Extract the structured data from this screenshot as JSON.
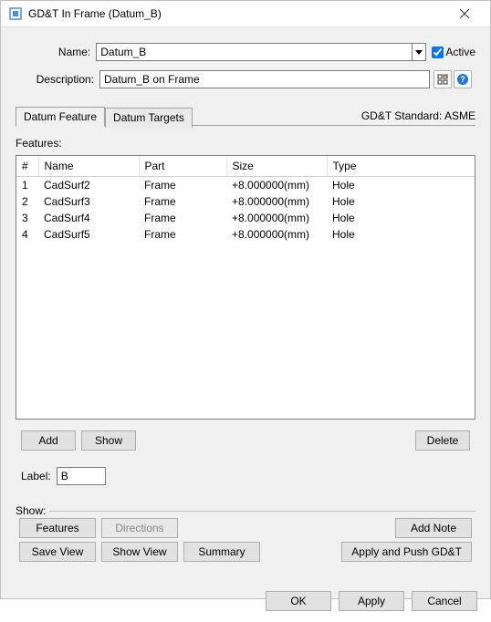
{
  "window": {
    "title": "GD&T In Frame (Datum_B)"
  },
  "form": {
    "nameLabel": "Name:",
    "nameValue": "Datum_B",
    "activeLabel": "Active",
    "activeChecked": true,
    "descLabel": "Description:",
    "descValue": "Datum_B on Frame"
  },
  "tabs": {
    "datumFeature": "Datum Feature",
    "datumTargets": "Datum Targets"
  },
  "standardText": "GD&T Standard: ASME",
  "featuresLabel": "Features:",
  "grid": {
    "columns": {
      "idx": "#",
      "name": "Name",
      "part": "Part",
      "size": "Size",
      "type": "Type"
    },
    "rows": [
      {
        "idx": "1",
        "name": "CadSurf2",
        "part": "Frame",
        "size": "+8.000000(mm)",
        "type": "Hole"
      },
      {
        "idx": "2",
        "name": "CadSurf3",
        "part": "Frame",
        "size": "+8.000000(mm)",
        "type": "Hole"
      },
      {
        "idx": "3",
        "name": "CadSurf4",
        "part": "Frame",
        "size": "+8.000000(mm)",
        "type": "Hole"
      },
      {
        "idx": "4",
        "name": "CadSurf5",
        "part": "Frame",
        "size": "+8.000000(mm)",
        "type": "Hole"
      }
    ]
  },
  "featureButtons": {
    "add": "Add",
    "show": "Show",
    "delete": "Delete"
  },
  "labelField": {
    "label": "Label:",
    "value": "B"
  },
  "showSection": {
    "legend": "Show:",
    "features": "Features",
    "directions": "Directions",
    "addNote": "Add Note",
    "saveView": "Save View",
    "showView": "Show View",
    "summary": "Summary",
    "applyPush": "Apply and Push GD&T"
  },
  "dialog": {
    "ok": "OK",
    "apply": "Apply",
    "cancel": "Cancel"
  }
}
